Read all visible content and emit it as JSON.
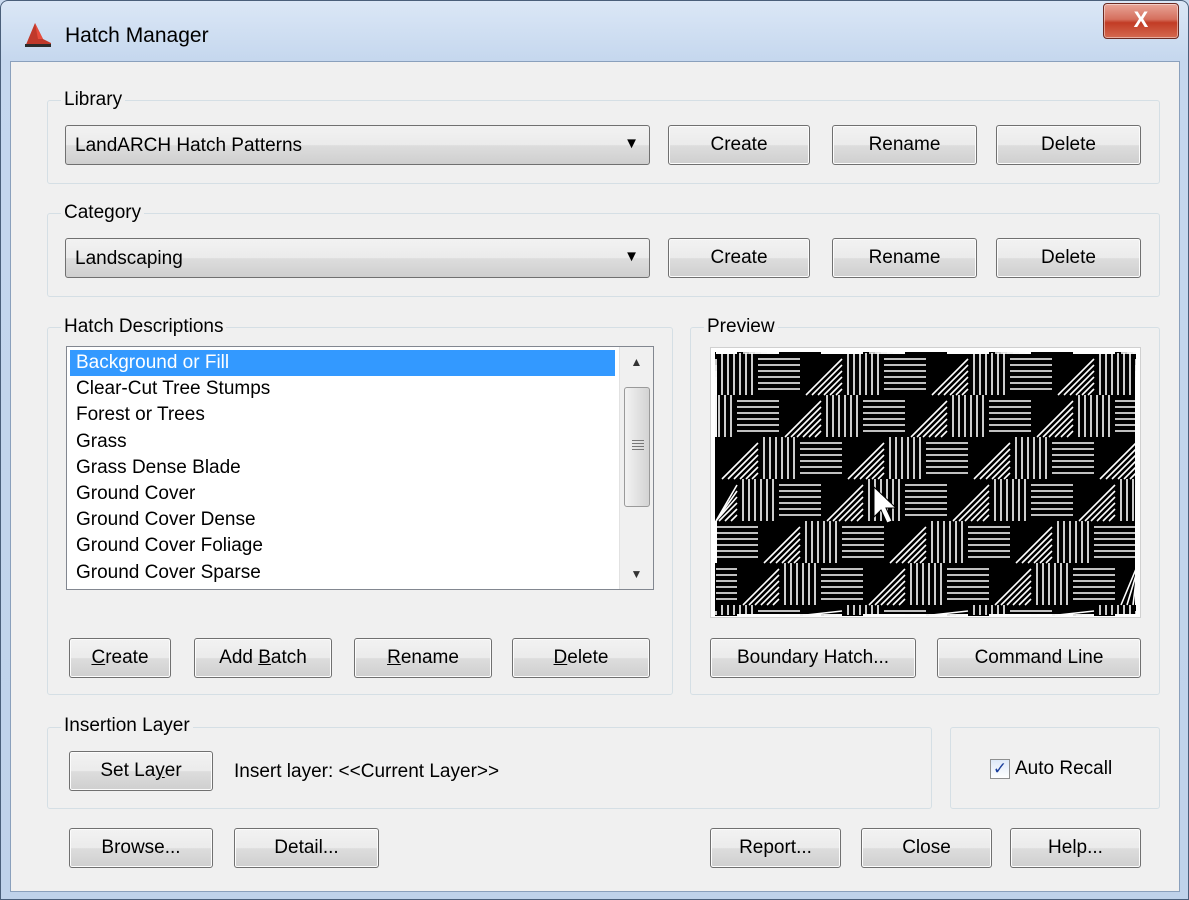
{
  "window": {
    "title": "Hatch Manager",
    "close_glyph": "X"
  },
  "library": {
    "legend": "Library",
    "selected": "LandARCH Hatch Patterns",
    "create_label": "Create",
    "rename_label": "Rename",
    "delete_label": "Delete"
  },
  "category": {
    "legend": "Category",
    "selected": "Landscaping",
    "create_label": "Create",
    "rename_label": "Rename",
    "delete_label": "Delete"
  },
  "hatch_descriptions": {
    "legend": "Hatch Descriptions",
    "items": [
      "Background or Fill",
      "Clear-Cut Tree Stumps",
      "Forest or Trees",
      "Grass",
      "Grass Dense Blade",
      "Ground Cover",
      "Ground Cover Dense",
      "Ground Cover Foliage",
      "Ground Cover Sparse"
    ],
    "selected_index": 0,
    "create_label": "Create",
    "add_batch_label": "Add Batch",
    "rename_label": "Rename",
    "delete_label": "Delete"
  },
  "preview": {
    "legend": "Preview",
    "boundary_hatch_label": "Boundary Hatch...",
    "command_line_label": "Command Line"
  },
  "insertion_layer": {
    "legend": "Insertion Layer",
    "set_layer_label": "Set Layer",
    "insert_layer_text": "Insert layer: <<Current Layer>>"
  },
  "auto_recall": {
    "label": "Auto Recall",
    "checked": true
  },
  "footer": {
    "browse_label": "Browse...",
    "detail_label": "Detail...",
    "report_label": "Report...",
    "close_label": "Close",
    "help_label": "Help..."
  },
  "colors": {
    "selection": "#3399ff",
    "preview_bg": "#000000",
    "pattern_line": "#ffffff"
  },
  "icons": [
    "app-icon",
    "close-icon",
    "dropdown-arrow-icon",
    "scroll-up-icon",
    "scroll-down-icon",
    "checkbox-check-icon",
    "mouse-cursor-icon"
  ]
}
